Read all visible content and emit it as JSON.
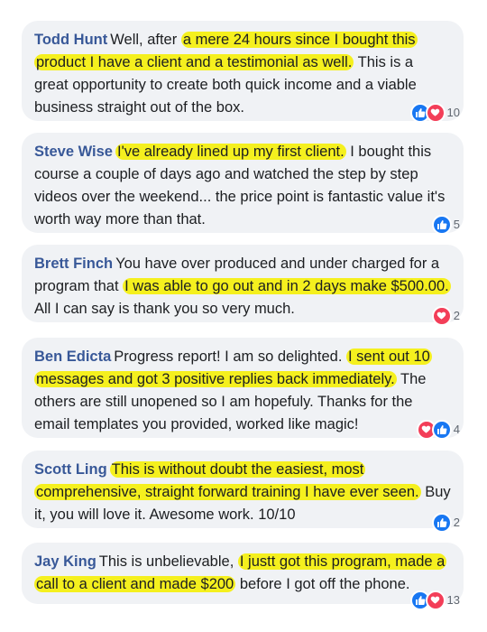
{
  "comments": [
    {
      "author": "Todd Hunt",
      "segments": [
        {
          "text": "Well, after ",
          "highlight": false
        },
        {
          "text": "a mere 24 hours since I bought this product I have a client and a testimonial as well.",
          "highlight": true
        },
        {
          "text": " This is a great opportunity to create both quick income and a viable business straight out of the box.",
          "highlight": false
        }
      ],
      "reactions": [
        "like-icon",
        "love-icon"
      ],
      "count": "10"
    },
    {
      "author": "Steve Wise",
      "segments": [
        {
          "text": "I've already lined up my first client.",
          "highlight": true
        },
        {
          "text": " I bought this course a couple of days ago and watched the step by step videos over the weekend... the price point is fantastic value it's worth way more than that.",
          "highlight": false
        }
      ],
      "reactions": [
        "like-icon"
      ],
      "count": "5"
    },
    {
      "author": "Brett Finch",
      "segments": [
        {
          "text": "You have over produced and under charged for a program that ",
          "highlight": false
        },
        {
          "text": "I was able to go out and in 2 days make $500.00.",
          "highlight": true
        },
        {
          "text": " All I can say is thank you so very much.",
          "highlight": false
        }
      ],
      "reactions": [
        "love-icon"
      ],
      "count": "2"
    },
    {
      "author": "Ben Edicta",
      "segments": [
        {
          "text": "Progress report! I am so delighted. ",
          "highlight": false
        },
        {
          "text": "I sent out 10 messages and got 3 positive replies back immediately.",
          "highlight": true
        },
        {
          "text": " The others are still unopened so I am hopefuly. Thanks for the email templates you provided, worked like magic!",
          "highlight": false
        }
      ],
      "reactions": [
        "love-icon",
        "like-icon"
      ],
      "count": "4"
    },
    {
      "author": "Scott Ling",
      "segments": [
        {
          "text": "This is without doubt the easiest, most comprehensive, straight forward training I have ever seen.",
          "highlight": true
        },
        {
          "text": " Buy it, you will love it. Awesome work. 10/10",
          "highlight": false
        }
      ],
      "reactions": [
        "like-icon"
      ],
      "count": "2"
    },
    {
      "author": "Jay King",
      "segments": [
        {
          "text": "This is unbelievable, ",
          "highlight": false
        },
        {
          "text": "I justt got this program, made a call to a client and made $200",
          "highlight": true
        },
        {
          "text": " before I got off the phone.",
          "highlight": false
        }
      ],
      "reactions": [
        "like-icon",
        "love-icon"
      ],
      "count": "13"
    }
  ],
  "colors": {
    "bubble": "#f0f2f5",
    "author": "#385898",
    "highlight": "#f5f01e",
    "like": "#1877f2",
    "love": "#f33e58",
    "text": "#1c1e21",
    "count": "#606770"
  }
}
